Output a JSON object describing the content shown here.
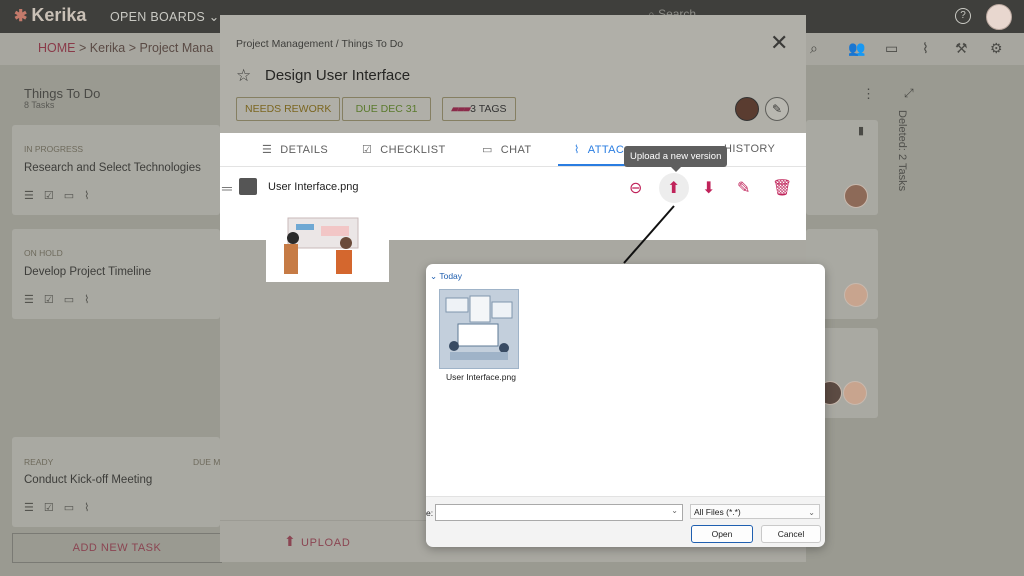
{
  "app": {
    "logo": "Kerika",
    "open_boards": "OPEN BOARDS",
    "search_placeholder": "Search"
  },
  "breadcrumb": {
    "home": "HOME",
    "sep1": ">",
    "board_group": "Kerika",
    "sep2": ">",
    "board": "Project Mana"
  },
  "lane": {
    "title": "Things To Do",
    "subtitle": "8 Tasks"
  },
  "cards": [
    {
      "status": "IN PROGRESS",
      "title": "Research and Select Technologies"
    },
    {
      "status": "ON HOLD",
      "title": "Develop Project Timeline"
    },
    {
      "status": "READY",
      "due": "DUE M",
      "title": "Conduct Kick-off Meeting"
    }
  ],
  "add_task": "ADD NEW TASK",
  "deleted_column": "Deleted: 2 Tasks",
  "modal": {
    "breadcrumb": "Project Management / Things To Do",
    "title": "Design User Interface",
    "chips": {
      "status": "NEEDS REWORK",
      "due": "DUE DEC 31",
      "tags": "3 TAGS"
    },
    "tabs": [
      "DETAILS",
      "CHECKLIST",
      "CHAT",
      "ATTAC",
      "HISTORY"
    ],
    "active_tab": "ATTACHMENTS",
    "attachment": {
      "filename": "User Interface.png"
    },
    "tooltip": "Upload a new version",
    "footer_upload": "UPLOAD"
  },
  "file_dialog": {
    "group": "Today",
    "file_name": "User Interface.png",
    "filename_label": "e:",
    "filename_value": "",
    "filetype": "All Files (*.*)",
    "open": "Open",
    "cancel": "Cancel"
  },
  "colors": {
    "accent": "#c0235a",
    "tab_active": "#2a7de1",
    "brand_dark": "#8b4552"
  }
}
